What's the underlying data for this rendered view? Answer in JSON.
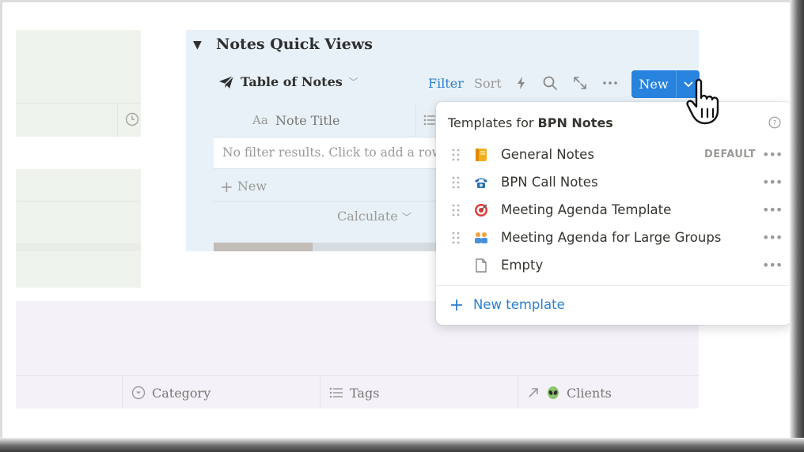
{
  "quick_views": {
    "title": "Notes Quick Views",
    "toggle": "▼",
    "view_name": "Table of Notes",
    "filter_label": "Filter",
    "sort_label": "Sort",
    "new_label": "New",
    "column_type_label": "Aa",
    "column_title": "Note Title",
    "empty_message": "No filter results. Click to add a row.",
    "new_row_label": "New",
    "calculate_label": "Calculate"
  },
  "bottom_table": {
    "columns": [
      {
        "label": "Category",
        "icon": "circle-chevron-icon"
      },
      {
        "label": "Tags",
        "icon": "list-icon"
      },
      {
        "label": "Clients",
        "icon": "relation-arrow-icon",
        "emoji": "👽"
      }
    ]
  },
  "templates_popup": {
    "heading_prefix": "Templates for",
    "heading_db": "BPN Notes",
    "default_badge": "DEFAULT",
    "items": [
      {
        "name": "General Notes",
        "emoji": "📒",
        "is_default": true
      },
      {
        "name": "BPN Call Notes",
        "emoji": "☎",
        "is_default": false
      },
      {
        "name": "Meeting Agenda Template",
        "emoji": "🎯",
        "is_default": false
      },
      {
        "name": "Meeting Agenda for Large Groups",
        "emoji": "👥",
        "is_default": false
      },
      {
        "name": "Empty",
        "emoji": "",
        "is_default": false
      }
    ],
    "new_template_label": "New template"
  },
  "colors": {
    "accent": "#2783de",
    "link": "#2b7fd0",
    "quick_view_bg": "#e8f1f7",
    "green_panel_bg": "#eef3ec",
    "lavender_bg": "#f4f2f8"
  }
}
